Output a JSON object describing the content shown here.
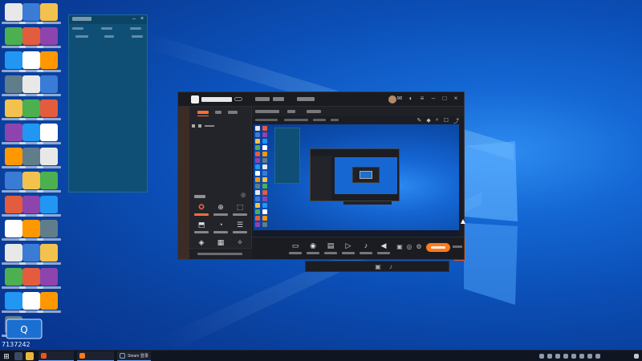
{
  "desktop": {
    "qq_number": "7137242"
  },
  "floating_panel": {
    "title": "",
    "rows": [
      "",
      ""
    ]
  },
  "app": {
    "title": "",
    "version": "",
    "tabs": [
      "",
      "",
      ""
    ],
    "left_tabs": [
      "",
      "",
      ""
    ],
    "tool_section_title": "",
    "live_button": "",
    "settings_label": ""
  },
  "taskbar": {
    "items": [
      {
        "label": "",
        "color": "#e8561c"
      },
      {
        "label": "",
        "color": "#ff7a1a"
      },
      {
        "label": "Steam 登录",
        "color": "#1b2838"
      }
    ],
    "clock_time": "",
    "clock_date": ""
  },
  "colors": {
    "accent_orange": "#ff7a1a",
    "panel_teal": "#0f4f76",
    "app_dark": "#1c1d22"
  }
}
